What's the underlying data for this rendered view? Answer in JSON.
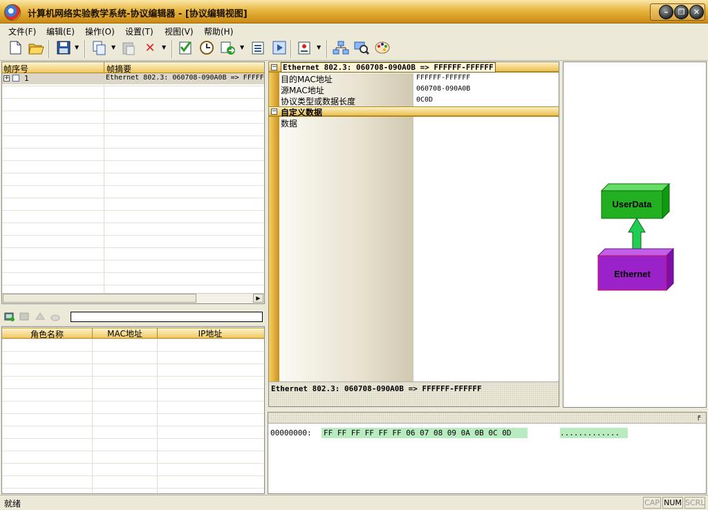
{
  "window": {
    "title": "计算机网络实验教学系统-协议编辑器 - [协议编辑视图]"
  },
  "menu": [
    {
      "label": "文件(F)"
    },
    {
      "label": "编辑(E)"
    },
    {
      "label": "操作(O)"
    },
    {
      "label": "设置(T)"
    },
    {
      "label": "视图(V)"
    },
    {
      "label": "帮助(H)"
    }
  ],
  "frames_table": {
    "columns": [
      "帧序号",
      "帧摘要"
    ],
    "rows": [
      {
        "index": "1",
        "summary": "Ethernet 802.3: 060708-090A0B => FFFFF"
      }
    ]
  },
  "roles_table": {
    "columns": [
      "角色名称",
      "MAC地址",
      "IP地址"
    ],
    "search_value": ""
  },
  "protocol_tree": {
    "header": "Ethernet 802.3: 060708-090A0B => FFFFFF-FFFFFF",
    "fields": [
      {
        "name": "目的MAC地址",
        "value": "FFFFFF-FFFFFF"
      },
      {
        "name": "源MAC地址",
        "value": "060708-090A0B"
      },
      {
        "name": "协议类型或数据长度",
        "value": "0C0D"
      }
    ],
    "custom_header": "自定义数据",
    "custom_fields": [
      {
        "name": "数据",
        "value": ""
      }
    ],
    "footer_summary": "Ethernet 802.3: 060708-090A0B => FFFFFF-FFFFFF"
  },
  "diagram": {
    "upper_box": "UserData",
    "lower_box": "Ethernet",
    "colors": {
      "upper": "#22b022",
      "lower": "#9a22c8",
      "arrow": "#22cc55"
    }
  },
  "hex": {
    "offset": "00000000:",
    "bytes": "FF FF FF FF FF FF 06 07 08 09 0A 0B 0C 0D",
    "ascii": ".............",
    "pin_icon": "pin-icon",
    "pin_glyph": "╒"
  },
  "status": {
    "text": "就绪",
    "cap": "CAP",
    "num": "NUM",
    "scrl": "SCRL"
  }
}
